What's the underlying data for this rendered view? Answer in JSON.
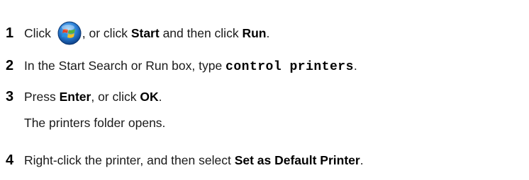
{
  "steps": [
    {
      "number": "1",
      "parts": [
        "Click ",
        ", or click ",
        "Start",
        " and then click ",
        "Run",
        "."
      ],
      "icon": "windows-start-orb-icon"
    },
    {
      "number": "2",
      "parts": [
        "In the Start Search or Run box, type ",
        "control printers",
        "."
      ]
    },
    {
      "number": "3",
      "parts": [
        "Press ",
        "Enter",
        ", or click ",
        "OK",
        "."
      ],
      "note": "The printers folder opens."
    },
    {
      "number": "4",
      "parts": [
        "Right-click the printer, and then select ",
        "Set as Default Printer",
        "."
      ]
    }
  ],
  "colors": {
    "text": "#1a1a1a",
    "orb_blue": "#1a6fcf",
    "flag_red": "#e8431f",
    "flag_green": "#54b33b",
    "flag_blue": "#2a8fe0",
    "flag_yellow": "#f5c021"
  }
}
